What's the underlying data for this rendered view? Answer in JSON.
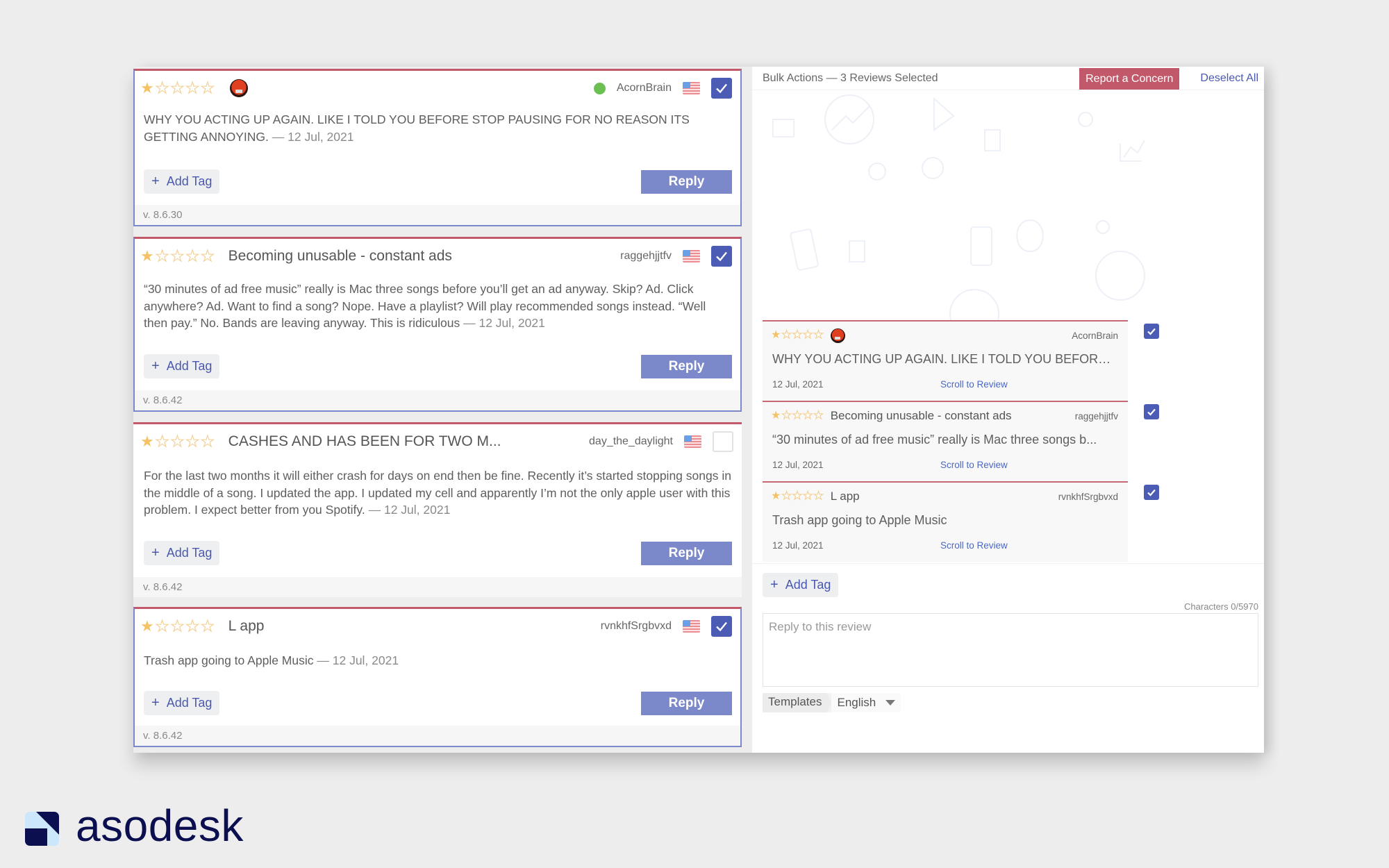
{
  "reviews": [
    {
      "rating": 1,
      "title": "",
      "has_avatar": true,
      "online": true,
      "author": "AcornBrain",
      "country": "US",
      "selected": true,
      "text": "WHY YOU ACTING UP AGAIN. LIKE I TOLD YOU BEFORE STOP PAUSING FOR NO REASON ITS GETTING ANNOYING.",
      "date": "— 12 Jul, 2021",
      "add_tag_label": "Add Tag",
      "reply_label": "Reply",
      "version": "v. 8.6.30"
    },
    {
      "rating": 1,
      "title": "Becoming unusable - constant ads",
      "author": "raggehjjtfv",
      "country": "US",
      "selected": true,
      "text": "“30 minutes of ad free music” really is Mac three songs before you’ll get an ad anyway. Skip? Ad. Click anywhere? Ad. Want to find a song? Nope. Have a playlist? Will play recommended songs instead. “Well then pay.” No. Bands are leaving anyway. This is ridiculous",
      "date": "— 12 Jul, 2021",
      "add_tag_label": "Add Tag",
      "reply_label": "Reply",
      "version": "v. 8.6.42"
    },
    {
      "rating": 1,
      "title": "CASHES AND HAS BEEN FOR TWO M...",
      "author": "day_the_daylight",
      "country": "US",
      "selected": false,
      "text": "For the last two months it will either crash for days on end then be fine. Recently it’s started stopping songs in the middle of a song. I updated the app. I updated my cell and apparently I’m not the only apple user with this problem. I expect better from you Spotify.",
      "date": "— 12 Jul, 2021",
      "add_tag_label": "Add Tag",
      "reply_label": "Reply",
      "version": "v. 8.6.42"
    },
    {
      "rating": 1,
      "title": "L app",
      "author": "rvnkhfSrgbvxd",
      "country": "US",
      "selected": true,
      "text": "Trash app going to Apple Music",
      "date": "— 12 Jul, 2021",
      "add_tag_label": "Add Tag",
      "reply_label": "Reply",
      "version": "v. 8.6.42"
    }
  ],
  "bulk": {
    "title": "Bulk Actions — 3 Reviews Selected",
    "report_label": "Report a Concern",
    "deselect_label": "Deselect All",
    "selected": [
      {
        "rating": 1,
        "title": "",
        "has_avatar": true,
        "author": "AcornBrain",
        "text": "WHY YOU ACTING UP AGAIN. LIKE I TOLD YOU BEFORE S...",
        "date": "12 Jul, 2021",
        "link": "Scroll to Review"
      },
      {
        "rating": 1,
        "title": "Becoming unusable - constant ads",
        "author": "raggehjjtfv",
        "text": "“30 minutes of ad free music” really is Mac three songs b...",
        "date": "12 Jul, 2021",
        "link": "Scroll to Review"
      },
      {
        "rating": 1,
        "title": "L app",
        "author": "rvnkhfSrgbvxd",
        "text": "Trash app going to Apple Music",
        "date": "12 Jul, 2021",
        "link": "Scroll to Review"
      }
    ],
    "add_tag_label": "Add Tag",
    "counter": "Characters 0/5970",
    "reply_placeholder": "Reply to this review",
    "reply_value": "",
    "templates_label": "Templates",
    "language": "English"
  },
  "brand": {
    "name": "asodesk"
  },
  "colors": {
    "accent": "#4c5bb3",
    "reply_button": "#7b88c9",
    "concern": "#c2596b",
    "star": "#f4c267",
    "online": "#6cc051"
  }
}
